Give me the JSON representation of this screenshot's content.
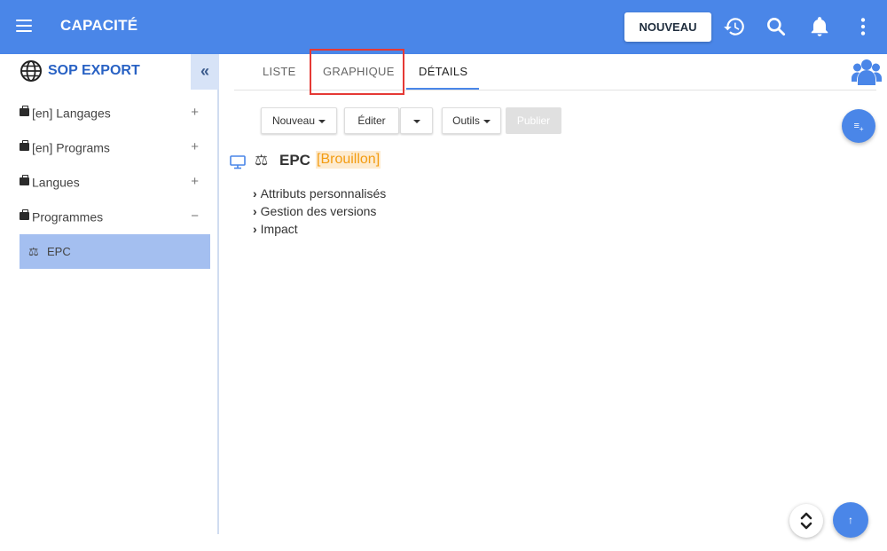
{
  "header": {
    "menu_icon": "hamburger-icon",
    "title": "CAPACITÉ",
    "new_button": "NOUVEAU",
    "icons": [
      "history-icon",
      "search-icon",
      "bell-icon",
      "more-vertical-icon"
    ]
  },
  "sidebar": {
    "title": "SOP EXPORT",
    "collapse_label": "«",
    "items": [
      {
        "label": "[en] Langages",
        "toggle": "+"
      },
      {
        "label": "[en] Programs",
        "toggle": "+"
      },
      {
        "label": "Langues",
        "toggle": "+"
      },
      {
        "label": "Programmes",
        "toggle": "−"
      }
    ],
    "active_child": {
      "icon": "⚖",
      "label": "EPC"
    }
  },
  "tabs": [
    {
      "label": "LISTE"
    },
    {
      "label": "GRAPHIQUE"
    },
    {
      "label": "DÉTAILS"
    }
  ],
  "toolbar": {
    "nouveau": "Nouveau",
    "editer": "Éditer",
    "outils": "Outils",
    "publier": "Publier"
  },
  "detail": {
    "scale_icon": "⚖",
    "title": "EPC",
    "status": "[Brouillon]",
    "sections": [
      {
        "label": "Attributs personnalisés"
      },
      {
        "label": "Gestion des versions"
      },
      {
        "label": "Impact"
      }
    ]
  },
  "colors": {
    "primary": "#4a86e8",
    "status_orange": "#f39c12",
    "highlight_red": "#e53935",
    "sidebar_active": "#a4bff0"
  }
}
